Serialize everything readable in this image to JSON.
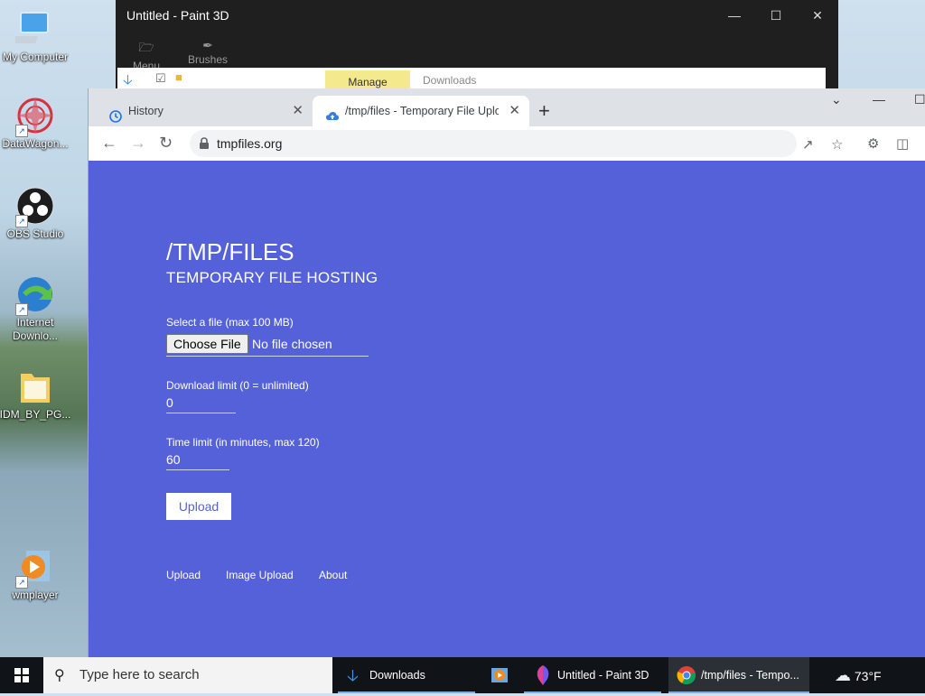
{
  "desktop": {
    "icons": [
      {
        "label": "My Computer",
        "icon": "monitor-icon"
      },
      {
        "label": "DataWagon...",
        "icon": "mandala-icon"
      },
      {
        "label": "OBS Studio",
        "icon": "obs-icon"
      },
      {
        "label": "Internet Downlo...",
        "icon": "idm-icon"
      },
      {
        "label": "IDM_BY_PG...",
        "icon": "folder-icon"
      },
      {
        "label": "wmplayer",
        "icon": "media-player-icon"
      }
    ]
  },
  "paint3d": {
    "title": "Untitled - Paint 3D",
    "tools": [
      "Menu",
      "Brushes"
    ],
    "ribbon": {
      "manage": "Manage",
      "downloads": "Downloads"
    }
  },
  "browser": {
    "tabs": [
      {
        "label": "History",
        "icon": "history-icon",
        "active": false
      },
      {
        "label": "/tmp/files - Temporary File Uploa",
        "icon": "cloud-upload-icon",
        "active": true
      }
    ],
    "url": "tmpfiles.org"
  },
  "page": {
    "title": "/TMP/FILES",
    "subtitle": "TEMPORARY FILE HOSTING",
    "file_label": "Select a file (max 100 MB)",
    "choose_file": "Choose File",
    "no_file": "No file chosen",
    "download_limit_label": "Download limit (0 = unlimited)",
    "download_limit_value": "0",
    "time_limit_label": "Time limit (in minutes, max 120)",
    "time_limit_value": "60",
    "upload_button": "Upload",
    "footer_links": [
      "Upload",
      "Image Upload",
      "About"
    ],
    "colors": {
      "background": "#5561d9",
      "text": "#ffffff"
    }
  },
  "taskbar": {
    "search_placeholder": "Type here to search",
    "items": [
      {
        "label": "Downloads",
        "icon": "download-arrow-icon"
      },
      {
        "label": "",
        "icon": "media-player-icon"
      },
      {
        "label": "Untitled - Paint 3D",
        "icon": "paint3d-icon"
      },
      {
        "label": "/tmp/files - Tempo...",
        "icon": "chrome-icon"
      }
    ],
    "weather": "73°F"
  }
}
